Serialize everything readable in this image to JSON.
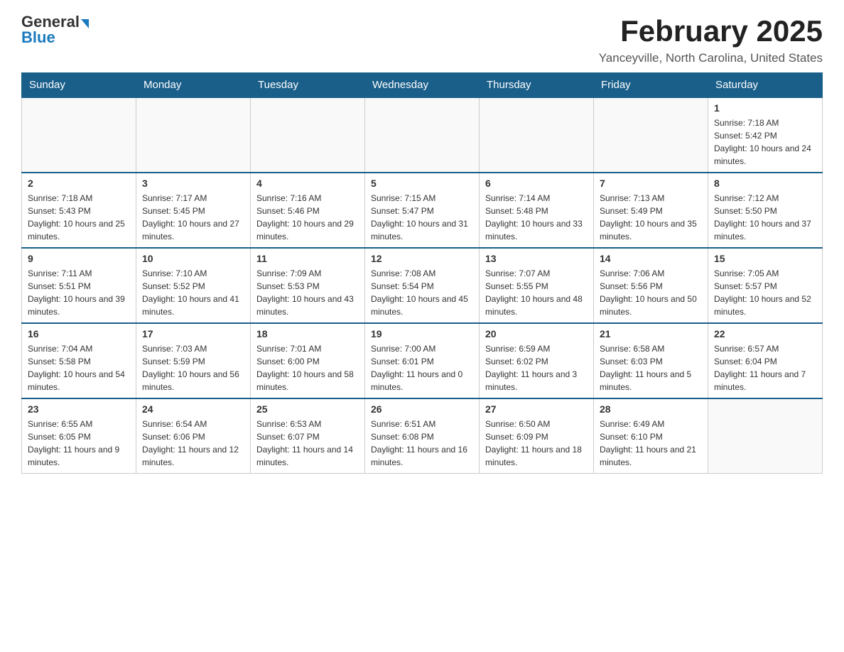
{
  "header": {
    "logo": {
      "general": "General",
      "blue": "Blue",
      "arrow": "▶"
    },
    "title": "February 2025",
    "location": "Yanceyville, North Carolina, United States"
  },
  "calendar": {
    "days_of_week": [
      "Sunday",
      "Monday",
      "Tuesday",
      "Wednesday",
      "Thursday",
      "Friday",
      "Saturday"
    ],
    "weeks": [
      {
        "days": [
          {
            "number": "",
            "info": "",
            "empty": true
          },
          {
            "number": "",
            "info": "",
            "empty": true
          },
          {
            "number": "",
            "info": "",
            "empty": true
          },
          {
            "number": "",
            "info": "",
            "empty": true
          },
          {
            "number": "",
            "info": "",
            "empty": true
          },
          {
            "number": "",
            "info": "",
            "empty": true
          },
          {
            "number": "1",
            "info": "Sunrise: 7:18 AM\nSunset: 5:42 PM\nDaylight: 10 hours and 24 minutes.",
            "empty": false
          }
        ]
      },
      {
        "days": [
          {
            "number": "2",
            "info": "Sunrise: 7:18 AM\nSunset: 5:43 PM\nDaylight: 10 hours and 25 minutes.",
            "empty": false
          },
          {
            "number": "3",
            "info": "Sunrise: 7:17 AM\nSunset: 5:45 PM\nDaylight: 10 hours and 27 minutes.",
            "empty": false
          },
          {
            "number": "4",
            "info": "Sunrise: 7:16 AM\nSunset: 5:46 PM\nDaylight: 10 hours and 29 minutes.",
            "empty": false
          },
          {
            "number": "5",
            "info": "Sunrise: 7:15 AM\nSunset: 5:47 PM\nDaylight: 10 hours and 31 minutes.",
            "empty": false
          },
          {
            "number": "6",
            "info": "Sunrise: 7:14 AM\nSunset: 5:48 PM\nDaylight: 10 hours and 33 minutes.",
            "empty": false
          },
          {
            "number": "7",
            "info": "Sunrise: 7:13 AM\nSunset: 5:49 PM\nDaylight: 10 hours and 35 minutes.",
            "empty": false
          },
          {
            "number": "8",
            "info": "Sunrise: 7:12 AM\nSunset: 5:50 PM\nDaylight: 10 hours and 37 minutes.",
            "empty": false
          }
        ]
      },
      {
        "days": [
          {
            "number": "9",
            "info": "Sunrise: 7:11 AM\nSunset: 5:51 PM\nDaylight: 10 hours and 39 minutes.",
            "empty": false
          },
          {
            "number": "10",
            "info": "Sunrise: 7:10 AM\nSunset: 5:52 PM\nDaylight: 10 hours and 41 minutes.",
            "empty": false
          },
          {
            "number": "11",
            "info": "Sunrise: 7:09 AM\nSunset: 5:53 PM\nDaylight: 10 hours and 43 minutes.",
            "empty": false
          },
          {
            "number": "12",
            "info": "Sunrise: 7:08 AM\nSunset: 5:54 PM\nDaylight: 10 hours and 45 minutes.",
            "empty": false
          },
          {
            "number": "13",
            "info": "Sunrise: 7:07 AM\nSunset: 5:55 PM\nDaylight: 10 hours and 48 minutes.",
            "empty": false
          },
          {
            "number": "14",
            "info": "Sunrise: 7:06 AM\nSunset: 5:56 PM\nDaylight: 10 hours and 50 minutes.",
            "empty": false
          },
          {
            "number": "15",
            "info": "Sunrise: 7:05 AM\nSunset: 5:57 PM\nDaylight: 10 hours and 52 minutes.",
            "empty": false
          }
        ]
      },
      {
        "days": [
          {
            "number": "16",
            "info": "Sunrise: 7:04 AM\nSunset: 5:58 PM\nDaylight: 10 hours and 54 minutes.",
            "empty": false
          },
          {
            "number": "17",
            "info": "Sunrise: 7:03 AM\nSunset: 5:59 PM\nDaylight: 10 hours and 56 minutes.",
            "empty": false
          },
          {
            "number": "18",
            "info": "Sunrise: 7:01 AM\nSunset: 6:00 PM\nDaylight: 10 hours and 58 minutes.",
            "empty": false
          },
          {
            "number": "19",
            "info": "Sunrise: 7:00 AM\nSunset: 6:01 PM\nDaylight: 11 hours and 0 minutes.",
            "empty": false
          },
          {
            "number": "20",
            "info": "Sunrise: 6:59 AM\nSunset: 6:02 PM\nDaylight: 11 hours and 3 minutes.",
            "empty": false
          },
          {
            "number": "21",
            "info": "Sunrise: 6:58 AM\nSunset: 6:03 PM\nDaylight: 11 hours and 5 minutes.",
            "empty": false
          },
          {
            "number": "22",
            "info": "Sunrise: 6:57 AM\nSunset: 6:04 PM\nDaylight: 11 hours and 7 minutes.",
            "empty": false
          }
        ]
      },
      {
        "days": [
          {
            "number": "23",
            "info": "Sunrise: 6:55 AM\nSunset: 6:05 PM\nDaylight: 11 hours and 9 minutes.",
            "empty": false
          },
          {
            "number": "24",
            "info": "Sunrise: 6:54 AM\nSunset: 6:06 PM\nDaylight: 11 hours and 12 minutes.",
            "empty": false
          },
          {
            "number": "25",
            "info": "Sunrise: 6:53 AM\nSunset: 6:07 PM\nDaylight: 11 hours and 14 minutes.",
            "empty": false
          },
          {
            "number": "26",
            "info": "Sunrise: 6:51 AM\nSunset: 6:08 PM\nDaylight: 11 hours and 16 minutes.",
            "empty": false
          },
          {
            "number": "27",
            "info": "Sunrise: 6:50 AM\nSunset: 6:09 PM\nDaylight: 11 hours and 18 minutes.",
            "empty": false
          },
          {
            "number": "28",
            "info": "Sunrise: 6:49 AM\nSunset: 6:10 PM\nDaylight: 11 hours and 21 minutes.",
            "empty": false
          },
          {
            "number": "",
            "info": "",
            "empty": true
          }
        ]
      }
    ]
  }
}
